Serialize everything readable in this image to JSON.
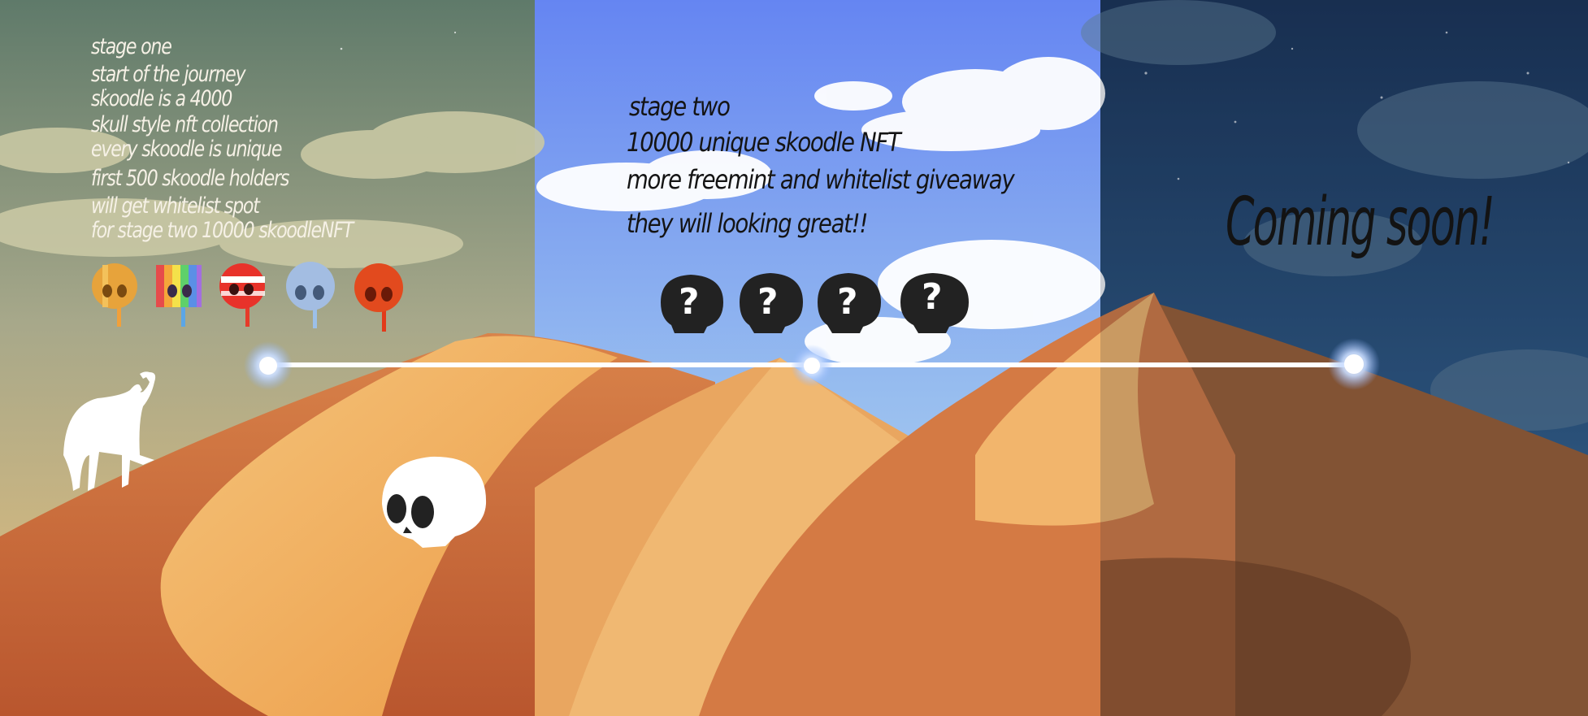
{
  "stage_one": {
    "lines": [
      "stage one",
      "start of the journey",
      "skoodle is a 4000",
      "skull style nft collection",
      "every skoodle is unique",
      "first 500 skoodle holders",
      "will get whitelist spot",
      "for stage two 10000 skoodleNFT"
    ]
  },
  "stage_two": {
    "lines": [
      "stage two",
      "10000 unique skoodle NFT",
      "more freemint and whitelist giveaway",
      "they will looking great!!"
    ],
    "mystery_mark": "?"
  },
  "stage_three": {
    "status": "Coming soon!"
  },
  "colors": {
    "sand_light": "#f2b868",
    "sand_dark": "#c96a3a",
    "sky_day": "#6a8cf2",
    "sky_night": "#1f3a5e",
    "sky_dusk": "#6f8a78",
    "node_glow": "#a9c8ff"
  },
  "icons": [
    "camel-silhouette-icon",
    "skull-icon",
    "gold-skull-lollipop-icon",
    "rainbow-skull-lollipop-icon",
    "red-striped-skull-lollipop-icon",
    "blue-skull-lollipop-icon",
    "red-skull-lollipop-icon",
    "mystery-skull-icon"
  ]
}
